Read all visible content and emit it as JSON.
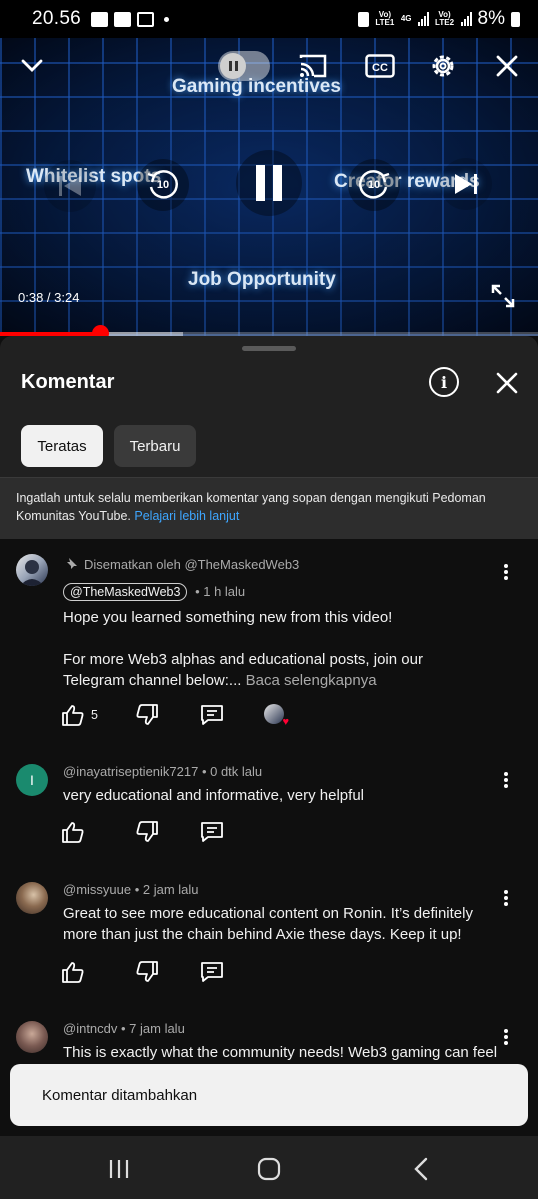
{
  "status_bar": {
    "time": "20.56",
    "net1": "Vo) LTE1",
    "net2": "4G",
    "net3": "Vo) LTE2",
    "battery": "8%"
  },
  "player": {
    "labels": {
      "top": "Gaming incentives",
      "left": "Whitelist spots",
      "right": "Creator rewards",
      "bottom": "Job Opportunity"
    },
    "seek_back": "10",
    "seek_forward": "10",
    "time": "0:38 / 3:24",
    "progress_fraction": 0.186,
    "buffered_fraction": 0.34
  },
  "sheet": {
    "title": "Komentar",
    "tabs": [
      "Teratas",
      "Terbaru"
    ],
    "guideline_text": "Ingatlah untuk selalu memberikan komentar yang sopan dengan mengikuti Pedoman Komunitas YouTube.",
    "guideline_link": "Pelajari lebih lanjut"
  },
  "comments": [
    {
      "pinned_label": "Disematkan oleh @TheMaskedWeb3",
      "author": "@TheMaskedWeb3",
      "time": "• 1 h lalu",
      "text_line1": "Hope you learned something new from this video!",
      "text_line2": "For more Web3 alphas and educational posts, join our Telegram channel below:...",
      "read_more": "Baca selengkapnya",
      "likes": "5"
    },
    {
      "avatar_letter": "I",
      "meta": "@inayatriseptienik7217 • 0 dtk lalu",
      "text": "very educational and informative, very helpful"
    },
    {
      "meta": "@missyuue • 2 jam lalu",
      "text": "Great to see more educational content on Ronin. It’s definitely more than just the chain behind Axie these days. Keep it up!"
    },
    {
      "meta": "@intncdv • 7 jam lalu",
      "text": "This is exactly what the community needs! Web3 gaming can feel"
    }
  ],
  "toast": {
    "text": "Komentar ditambahkan"
  },
  "colors": {
    "accent_red": "#ff0000",
    "link_blue": "#3ea6ff",
    "sheet_bg": "#212121",
    "comment_bg": "#0f0f0f",
    "avatar_teal": "#1a8a6e"
  }
}
